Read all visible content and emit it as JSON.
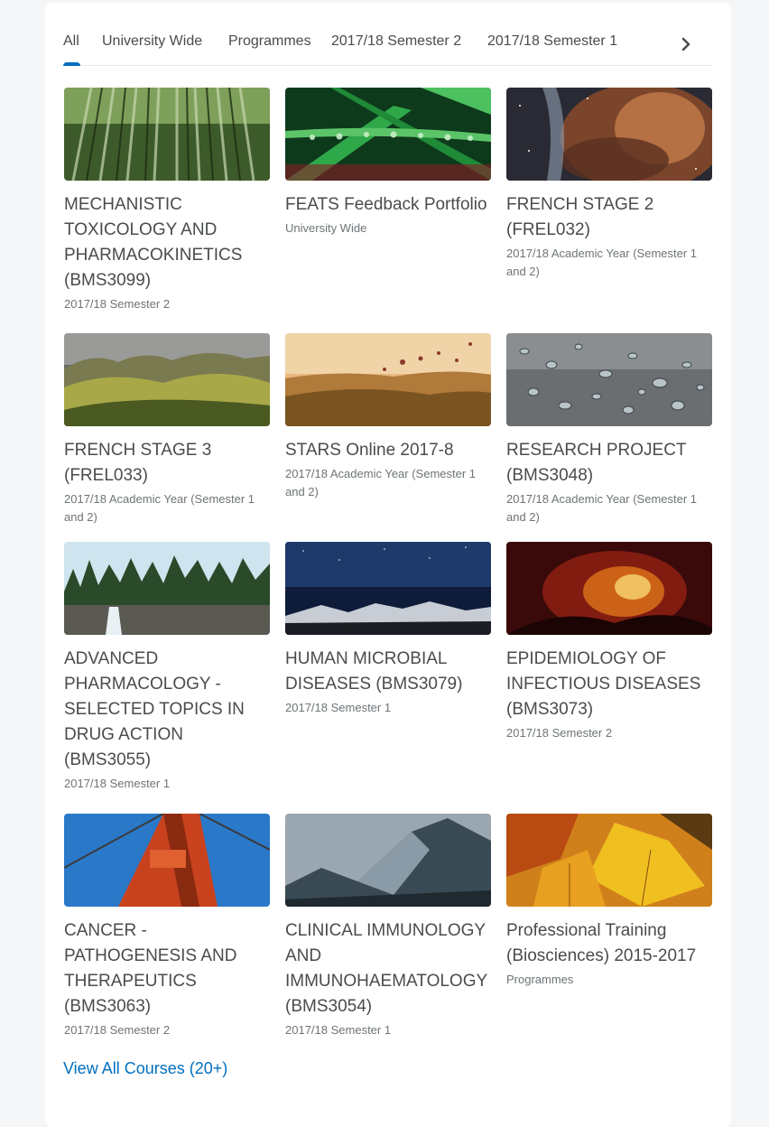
{
  "tabs": [
    {
      "label": "All"
    },
    {
      "label": "University Wide"
    },
    {
      "label": "Programmes"
    },
    {
      "label": "2017/18 Semester 2"
    },
    {
      "label": "2017/18 Semester 1"
    }
  ],
  "tab_next_icon": "chevron-right-icon",
  "courses": [
    {
      "title": "MECHANISTIC TOXICOLOGY AND PHARMACOKINETICS (BMS3099)",
      "subtitle": "2017/18 Semester 2",
      "image": "bamboo-forest"
    },
    {
      "title": "FEATS Feedback Portfolio",
      "subtitle": "University Wide",
      "image": "water-droplets-on-grass"
    },
    {
      "title": "FRENCH STAGE 2 (FREL032)",
      "subtitle": "2017/18 Academic Year (Semester 1 and 2)",
      "image": "nebula"
    },
    {
      "title": "FRENCH STAGE 3 (FREL033)",
      "subtitle": "2017/18 Academic Year (Semester 1 and 2)",
      "image": "green-hills"
    },
    {
      "title": "STARS Online 2017-8",
      "subtitle": "2017/18 Academic Year (Semester 1 and 2)",
      "image": "hot-air-balloons"
    },
    {
      "title": "RESEARCH PROJECT (BMS3048)",
      "subtitle": "2017/18 Academic Year (Semester 1 and 2)",
      "image": "water-drops"
    },
    {
      "title": "ADVANCED PHARMACOLOGY - SELECTED TOPICS IN DRUG ACTION (BMS3055)",
      "subtitle": "2017/18 Semester 1",
      "image": "forest-waterfall"
    },
    {
      "title": "HUMAN MICROBIAL DISEASES (BMS3079)",
      "subtitle": "2017/18 Semester 1",
      "image": "night-mountains"
    },
    {
      "title": "EPIDEMIOLOGY OF INFECTIOUS DISEASES (BMS3073)",
      "subtitle": "2017/18 Semester 2",
      "image": "fire-nebula"
    },
    {
      "title": "CANCER - PATHOGENESIS AND THERAPEUTICS (BMS3063)",
      "subtitle": "2017/18 Semester 2",
      "image": "red-bridge"
    },
    {
      "title": "CLINICAL IMMUNOLOGY AND IMMUNOHAEMATOLOGY (BMS3054)",
      "subtitle": "2017/18 Semester 1",
      "image": "rocky-mountain"
    },
    {
      "title": "Professional Training (Biosciences) 2015-2017",
      "subtitle": "Programmes",
      "image": "autumn-leaves"
    }
  ],
  "view_all_label": "View All Courses (20+)",
  "colors": {
    "accent": "#006fbf",
    "text": "#494c4e",
    "subtext": "#6e7477",
    "background": "#f5f6f8"
  }
}
